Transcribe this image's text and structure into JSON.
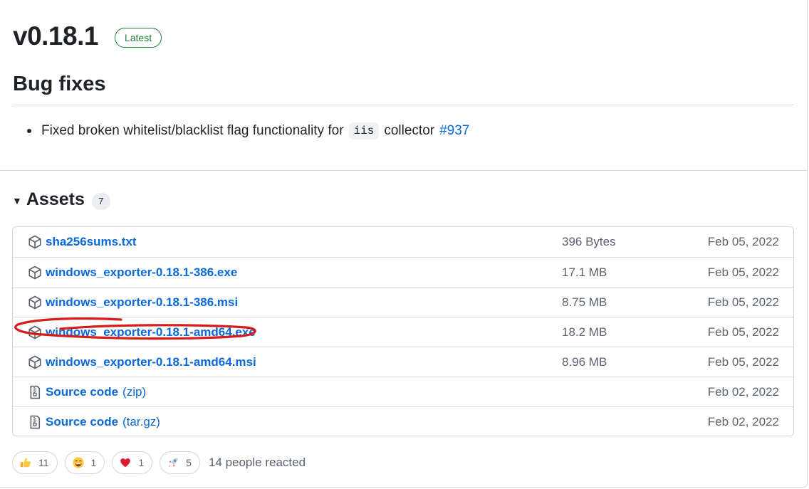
{
  "release": {
    "version": "v0.18.1",
    "badge": "Latest",
    "heading": "Bug fixes",
    "note": {
      "text_before": "Fixed broken whitelist/blacklist flag functionality for",
      "code": "iis",
      "text_after": "collector",
      "issue": "#937"
    }
  },
  "assets": {
    "label": "Assets",
    "count": "7",
    "rows": [
      {
        "name": "sha256sums.txt",
        "sub": "",
        "size": "396 Bytes",
        "date": "Feb 05, 2022",
        "icon": "package-icon"
      },
      {
        "name": "windows_exporter-0.18.1-386.exe",
        "sub": "",
        "size": "17.1 MB",
        "date": "Feb 05, 2022",
        "icon": "package-icon"
      },
      {
        "name": "windows_exporter-0.18.1-386.msi",
        "sub": "",
        "size": "8.75 MB",
        "date": "Feb 05, 2022",
        "icon": "package-icon"
      },
      {
        "name": "windows_exporter-0.18.1-amd64.exe",
        "sub": "",
        "size": "18.2 MB",
        "date": "Feb 05, 2022",
        "icon": "package-icon"
      },
      {
        "name": "windows_exporter-0.18.1-amd64.msi",
        "sub": "",
        "size": "8.96 MB",
        "date": "Feb 05, 2022",
        "icon": "package-icon"
      },
      {
        "name": "Source code",
        "sub": "(zip)",
        "size": "",
        "date": "Feb 02, 2022",
        "icon": "file-zip-icon"
      },
      {
        "name": "Source code",
        "sub": "(tar.gz)",
        "size": "",
        "date": "Feb 02, 2022",
        "icon": "file-zip-icon"
      }
    ]
  },
  "reactions": {
    "items": [
      {
        "emoji": "thumbs-up",
        "count": "11"
      },
      {
        "emoji": "laugh",
        "count": "1"
      },
      {
        "emoji": "heart",
        "count": "1"
      },
      {
        "emoji": "rocket",
        "count": "5"
      }
    ],
    "summary": "14 people reacted"
  },
  "colors": {
    "link": "#0969da",
    "latest": "#1a7f37",
    "annotation": "#d81b1b"
  }
}
